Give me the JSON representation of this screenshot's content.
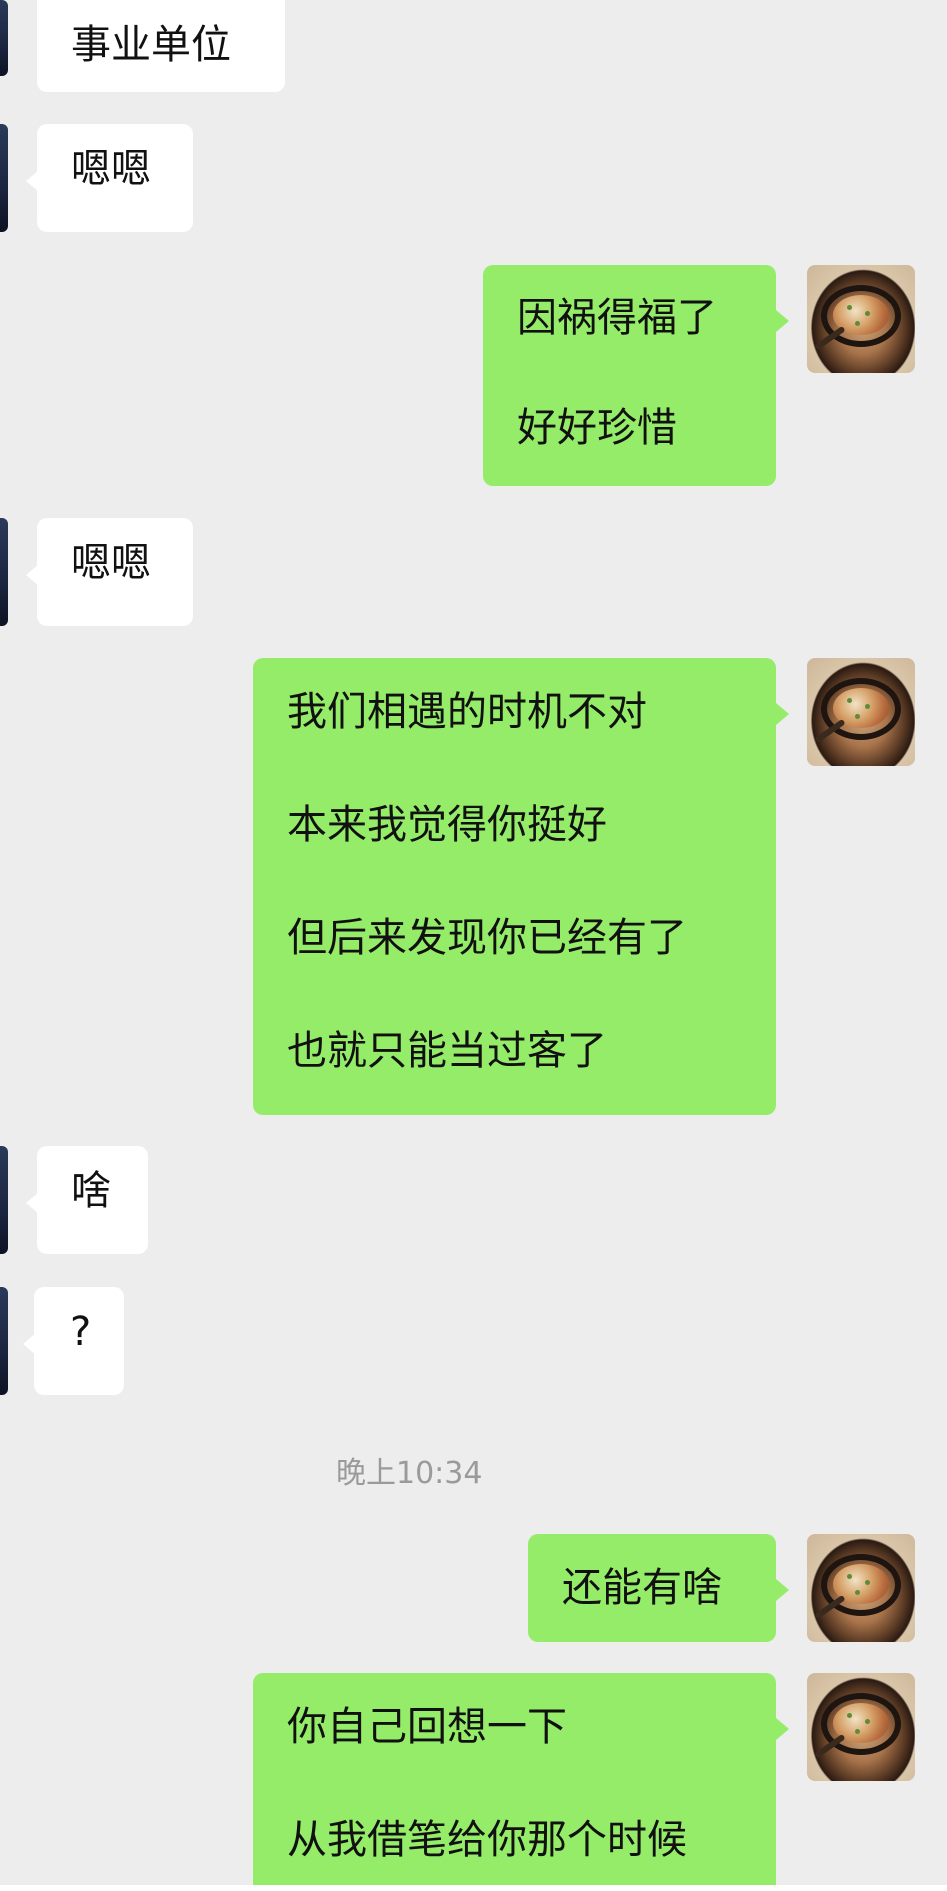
{
  "chat": {
    "messages": [
      {
        "side": "left",
        "lines": [
          "事业单位"
        ]
      },
      {
        "side": "left",
        "lines": [
          "嗯嗯"
        ]
      },
      {
        "side": "right",
        "lines": [
          "因祸得福了",
          "好好珍惜"
        ]
      },
      {
        "side": "left",
        "lines": [
          "嗯嗯"
        ]
      },
      {
        "side": "right",
        "lines": [
          "我们相遇的时机不对",
          "本来我觉得你挺好",
          "但后来发现你已经有了",
          "也就只能当过客了"
        ]
      },
      {
        "side": "left",
        "lines": [
          "啥"
        ]
      },
      {
        "side": "left",
        "lines": [
          "?"
        ]
      },
      {
        "side": "right",
        "lines": [
          "还能有啥"
        ]
      },
      {
        "side": "right",
        "lines": [
          "你自己回想一下",
          "从我借笔给你那个时候"
        ]
      }
    ],
    "timestamp": "晚上10:34"
  },
  "colors": {
    "background": "#ededed",
    "incoming_bubble": "#ffffff",
    "outgoing_bubble": "#95ec69",
    "timestamp_text": "#9a9a9a"
  },
  "icons": {
    "incoming_avatar": "contact-avatar-icon",
    "outgoing_avatar": "food-photo-avatar-icon"
  }
}
